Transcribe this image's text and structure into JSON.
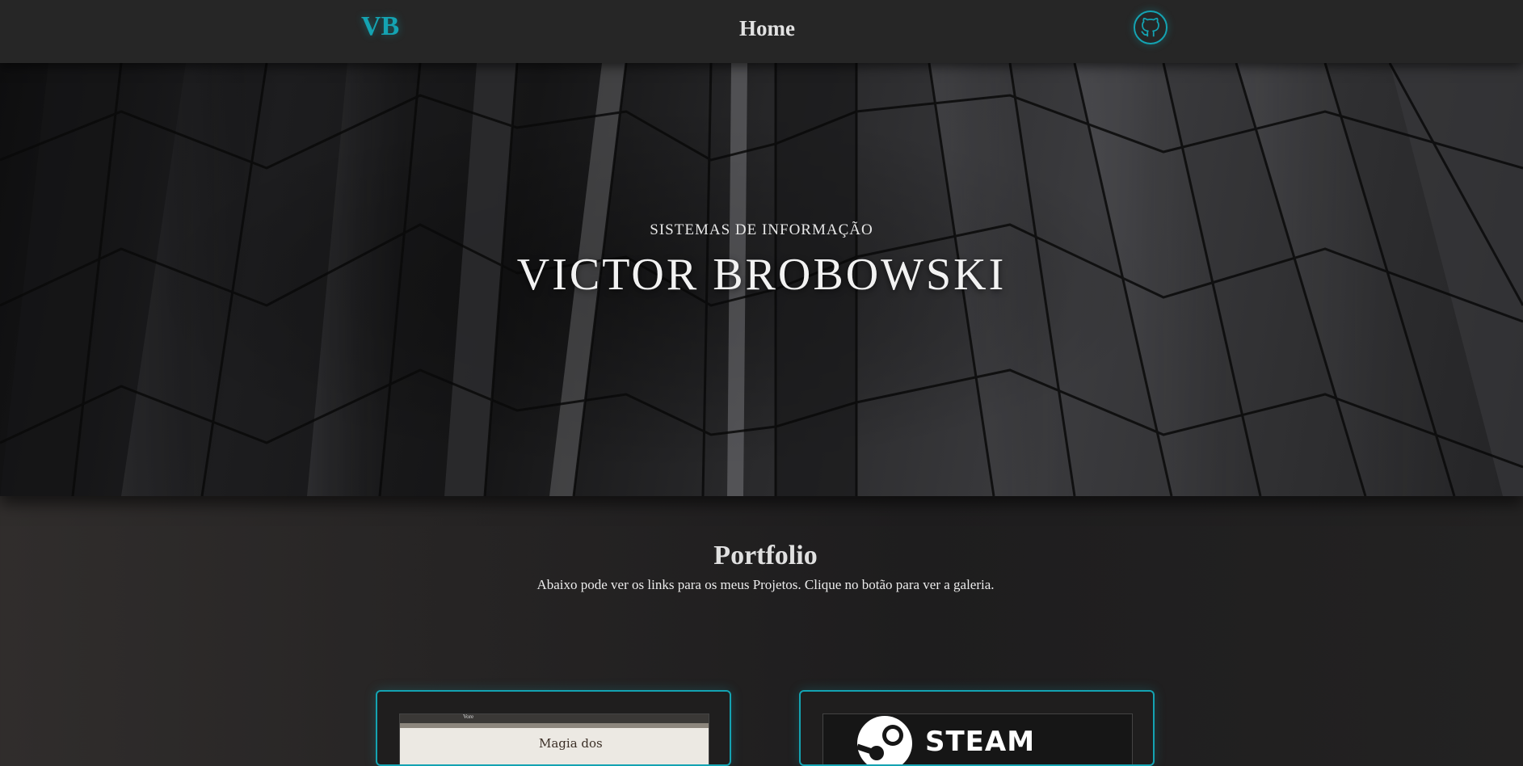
{
  "nav": {
    "logo": "VB",
    "home": "Home",
    "github_icon": "github-icon"
  },
  "hero": {
    "subtitle": "SISTEMAS DE INFORMAÇÃO",
    "title": "VICTOR BROBOWSKI"
  },
  "portfolio": {
    "title": "Portfolio",
    "description": "Abaixo pode ver os links para os meus Projetos. Clique no botão para ver a galeria.",
    "cards": [
      {
        "thumb_text": "Magia dos",
        "nav_name": "Vore"
      },
      {
        "thumb_text": "STEAM"
      }
    ]
  },
  "colors": {
    "accent": "#14a3b2",
    "topbar": "#262626",
    "background": "#262424"
  }
}
